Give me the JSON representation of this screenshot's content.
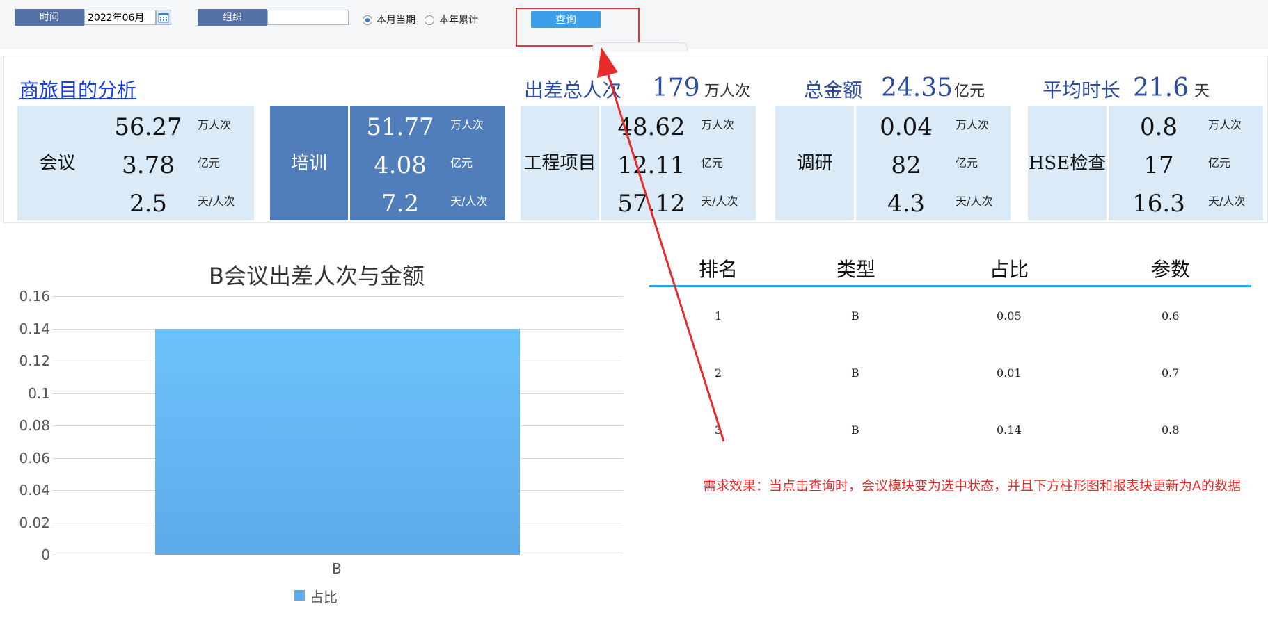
{
  "filters": {
    "time_label": "时间",
    "time_value": "2022年06月",
    "org_label": "组织",
    "org_value": "",
    "radio_current": "本月当期",
    "radio_cumulative": "本年累计",
    "query_button": "查询"
  },
  "summary": {
    "title": "商旅目的分析",
    "trips_label": "出差总人次",
    "trips_value": "179",
    "trips_unit": "万人次",
    "amount_label": "总金额",
    "amount_value": "24.35",
    "amount_unit": "亿元",
    "duration_label": "平均时长",
    "duration_value": "21.6",
    "duration_unit": "天"
  },
  "cards": [
    {
      "name": "会议",
      "trips": "56.27",
      "amount": "3.78",
      "days": "2.5",
      "trips_unit": "万人次",
      "amount_unit": "亿元",
      "days_unit": "天/人次"
    },
    {
      "name": "培训",
      "trips": "51.77",
      "amount": "4.08",
      "days": "7.2",
      "trips_unit": "万人次",
      "amount_unit": "亿元",
      "days_unit": "天/人次"
    },
    {
      "name": "工程项目",
      "name_l1": "工程",
      "name_l2": "项目",
      "trips": "48.62",
      "amount": "12.11",
      "days": "57.12",
      "trips_unit": "万人次",
      "amount_unit": "亿元",
      "days_unit": "天/人次"
    },
    {
      "name": "调研",
      "trips": "0.04",
      "amount": "82",
      "days": "4.3",
      "trips_unit": "万人次",
      "amount_unit": "亿元",
      "days_unit": "天/人次"
    },
    {
      "name": "HSE检查",
      "name_l1": "HSE",
      "name_l2": "检查",
      "trips": "0.8",
      "amount": "17",
      "days": "16.3",
      "trips_unit": "万人次",
      "amount_unit": "亿元",
      "days_unit": "天/人次"
    }
  ],
  "chart_data": {
    "type": "bar",
    "title": "B会议出差人次与金额",
    "categories": [
      "B"
    ],
    "series": [
      {
        "name": "占比",
        "values": [
          0.14
        ]
      }
    ],
    "ylim": [
      0,
      0.16
    ],
    "yticks": [
      "0.16",
      "0.14",
      "0.12",
      "0.1",
      "0.08",
      "0.06",
      "0.04",
      "0.02",
      "0"
    ],
    "grid": true,
    "legend": "bottom",
    "color": "#5eaaea"
  },
  "table": {
    "headers": [
      "排名",
      "类型",
      "占比",
      "参数"
    ],
    "rows": [
      [
        "1",
        "B",
        "0.05",
        "0.6"
      ],
      [
        "2",
        "B",
        "0.01",
        "0.7"
      ],
      [
        "3",
        "B",
        "0.14",
        "0.8"
      ]
    ]
  },
  "annotation": "需求效果：当点击查询时，会议模块变为选中状态，并且下方柱形图和报表块更新为A的数据",
  "colors": {
    "accent": "#3d9ee9",
    "selected_card": "#4f7ebb",
    "card": "#daeaf6",
    "annotation": "#e72a2a"
  }
}
